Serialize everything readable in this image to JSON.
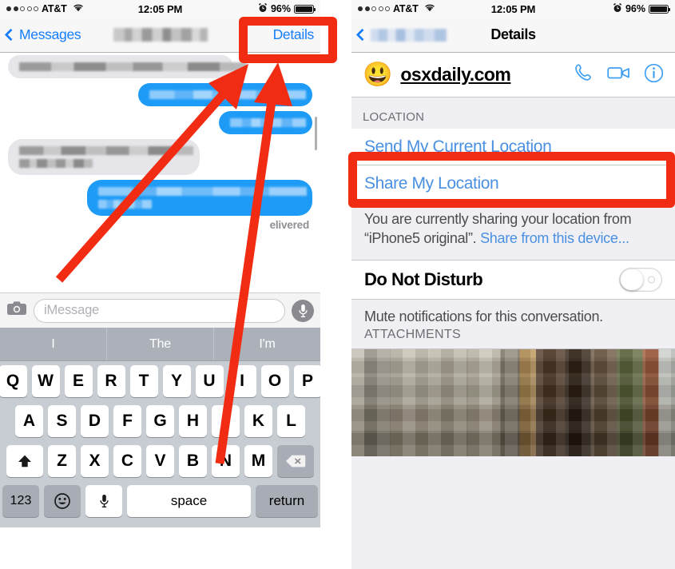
{
  "left_panel": {
    "status_bar": {
      "signal_dots_filled": 2,
      "signal_dots_total": 5,
      "carrier": "AT&T",
      "wifi_icon": "wifi-icon",
      "time": "12:05 PM",
      "alarm_icon": "alarm-clock-icon",
      "battery_percent": "96%"
    },
    "nav_bar": {
      "back_icon": "chevron-left-icon",
      "back_label": "Messages",
      "title_redacted": true,
      "right_action": "Details"
    },
    "thread": {
      "delivered_label": "elivered",
      "messages": [
        {
          "side": "left",
          "kind": "gray",
          "lines": [
            1
          ]
        },
        {
          "side": "right",
          "kind": "blue",
          "lines": [
            1
          ]
        },
        {
          "side": "right",
          "kind": "blue",
          "lines": [
            1
          ]
        },
        {
          "side": "left",
          "kind": "gray",
          "lines": [
            1,
            2
          ]
        },
        {
          "side": "right",
          "kind": "blue",
          "lines": [
            1,
            2
          ]
        }
      ]
    },
    "input_bar": {
      "camera_icon": "camera-icon",
      "placeholder": "iMessage",
      "mic_icon": "microphone-icon"
    },
    "keyboard": {
      "predictions": [
        "I",
        "The",
        "I'm"
      ],
      "row1": [
        "Q",
        "W",
        "E",
        "R",
        "T",
        "Y",
        "U",
        "I",
        "O",
        "P"
      ],
      "row2": [
        "A",
        "S",
        "D",
        "F",
        "G",
        "H",
        "J",
        "K",
        "L"
      ],
      "row3": [
        "Z",
        "X",
        "C",
        "V",
        "B",
        "N",
        "M"
      ],
      "shift_icon": "shift-arrow-icon",
      "delete_icon": "backspace-icon",
      "numeric_key": "123",
      "emoji_icon": "smiley-face-icon",
      "dictation_icon": "microphone-icon",
      "space_key": "space",
      "return_key": "return"
    }
  },
  "right_panel": {
    "status_bar": {
      "signal_dots_filled": 2,
      "signal_dots_total": 5,
      "carrier": "AT&T",
      "wifi_icon": "wifi-icon",
      "time": "12:05 PM",
      "alarm_icon": "alarm-clock-icon",
      "battery_percent": "96%"
    },
    "nav_bar": {
      "back_icon": "chevron-left-icon",
      "back_label_redacted": true,
      "title": "Details"
    },
    "contact": {
      "avatar_emoji": "😃",
      "name": "osxdaily.com",
      "phone_icon": "phone-handset-icon",
      "video_icon": "video-camera-icon",
      "info_icon": "info-circle-icon"
    },
    "location_section": {
      "header": "LOCATION",
      "send_current": "Send My Current Location",
      "share_my_location": "Share My Location",
      "note_text_1": "You are currently sharing your location from “iPhone5 original”. ",
      "note_link": "Share from this device..."
    },
    "dnd": {
      "label": "Do Not Disturb",
      "toggle_state": "off",
      "note": "Mute notifications for this conversation."
    },
    "attachments": {
      "header": "ATTACHMENTS"
    }
  },
  "annotations": {
    "highlight_color": "#f22c12",
    "boxes": [
      {
        "name": "details-button-highlight",
        "target": "Details"
      },
      {
        "name": "send-my-current-location-highlight",
        "target": "Send My Current Location"
      }
    ],
    "arrows": [
      {
        "name": "arrow-to-details-1"
      },
      {
        "name": "arrow-to-details-2"
      }
    ]
  }
}
